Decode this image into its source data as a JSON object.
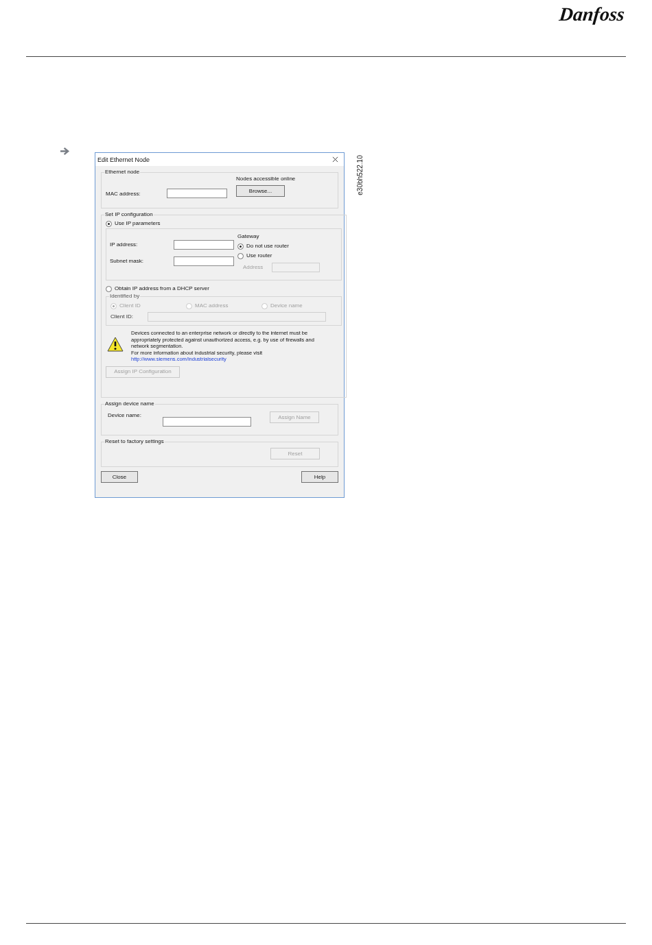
{
  "header": {
    "logo": "Danfoss"
  },
  "figure_code": "e30bh522.10",
  "dialog": {
    "title": "Edit Ethernet Node",
    "ethernet_node": {
      "legend": "Ethernet node",
      "nodes_label": "Nodes accessible online",
      "mac_label": "MAC address:",
      "browse_button": "Browse..."
    },
    "ip_config": {
      "legend": "Set IP configuration",
      "modes": [
        {
          "label": "Use IP parameters",
          "selected": true
        },
        {
          "label": "Obtain IP address from a DHCP server",
          "selected": false
        }
      ],
      "ip_label": "IP address:",
      "subnet_label": "Subnet mask:",
      "gateway_label": "Gateway",
      "gateway_options": [
        {
          "label": "Do not use router",
          "selected": true
        },
        {
          "label": "Use router",
          "selected": false
        }
      ],
      "address_label": "Address",
      "address_disabled": true,
      "identified_by": {
        "legend": "Identified by",
        "disabled": true,
        "options": [
          {
            "label": "Client ID",
            "selected": true
          },
          {
            "label": "MAC address",
            "selected": false
          },
          {
            "label": "Device name",
            "selected": false
          }
        ],
        "client_id_label": "Client ID:"
      },
      "warning": "Devices connected to an enterprise network or directly to the internet must be appropriately protected against unauthorized access, e.g. by use of firewalls and network segmentation.",
      "info": "For more information about industrial security, please visit",
      "link": "http://www.siemens.com/industrialsecurity",
      "assign_button": {
        "label": "Assign IP Configuration",
        "disabled": true
      }
    },
    "device_name": {
      "legend": "Assign device name",
      "label": "Device name:",
      "button": {
        "label": "Assign Name",
        "disabled": true
      }
    },
    "reset": {
      "legend": "Reset to factory settings",
      "button": {
        "label": "Reset",
        "disabled": true
      }
    },
    "buttons": [
      {
        "label": "Close",
        "disabled": false
      },
      {
        "label": "Help",
        "disabled": false
      }
    ]
  }
}
